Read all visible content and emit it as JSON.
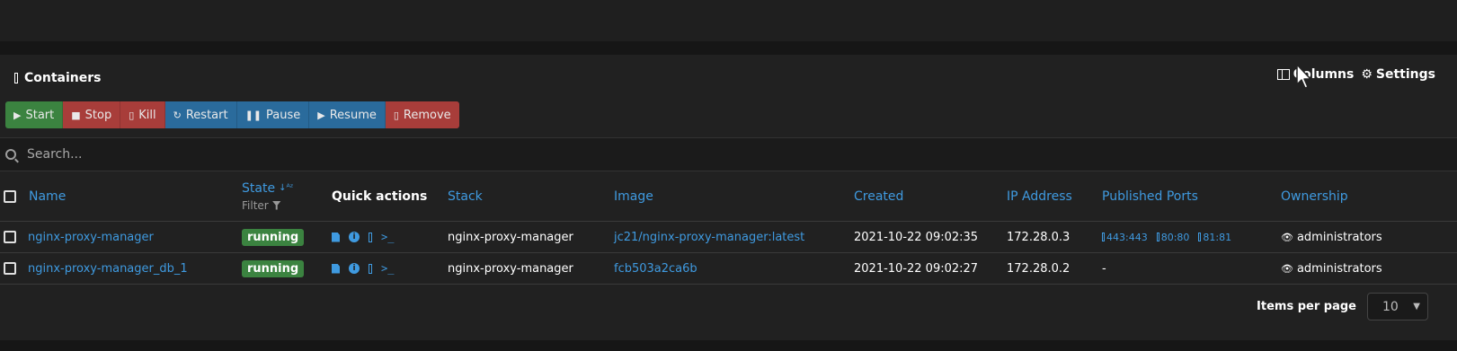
{
  "header": {
    "title": "Containers",
    "columns_label": "Columns",
    "settings_label": "Settings"
  },
  "actions": [
    {
      "label": "Start",
      "icon": "play-icon",
      "color": "#3b8340"
    },
    {
      "label": "Stop",
      "icon": "stop-icon",
      "color": "#a83d3a"
    },
    {
      "label": "Kill",
      "icon": "bomb-icon",
      "color": "#a83d3a"
    },
    {
      "label": "Restart",
      "icon": "refresh-icon",
      "color": "#2a6b9c"
    },
    {
      "label": "Pause",
      "icon": "pause-icon",
      "color": "#2a6b9c"
    },
    {
      "label": "Resume",
      "icon": "play-icon",
      "color": "#2a6b9c"
    },
    {
      "label": "Remove",
      "icon": "trash-icon",
      "color": "#a83d3a"
    }
  ],
  "search": {
    "placeholder": "Search...",
    "value": ""
  },
  "table": {
    "headers": {
      "name": "Name",
      "state": "State",
      "state_filter": "Filter",
      "quick_actions": "Quick actions",
      "stack": "Stack",
      "image": "Image",
      "created": "Created",
      "ip": "IP Address",
      "ports": "Published Ports",
      "ownership": "Ownership"
    },
    "rows": [
      {
        "name": "nginx-proxy-manager",
        "state": "running",
        "stack": "nginx-proxy-manager",
        "image": "jc21/nginx-proxy-manager:latest",
        "created": "2021-10-22 09:02:35",
        "ip": "172.28.0.3",
        "ports": [
          "443:443",
          "80:80",
          "81:81"
        ],
        "ownership": "administrators"
      },
      {
        "name": "nginx-proxy-manager_db_1",
        "state": "running",
        "stack": "nginx-proxy-manager",
        "image": "fcb503a2ca6b",
        "created": "2021-10-22 09:02:27",
        "ip": "172.28.0.2",
        "ports_text": "-",
        "ownership": "administrators"
      }
    ]
  },
  "pagination": {
    "label": "Items per page",
    "value": "10"
  },
  "colors": {
    "link": "#3f9ae0",
    "success": "#3b8340",
    "danger": "#a83d3a",
    "primary": "#2a6b9c",
    "panel": "#212121"
  }
}
